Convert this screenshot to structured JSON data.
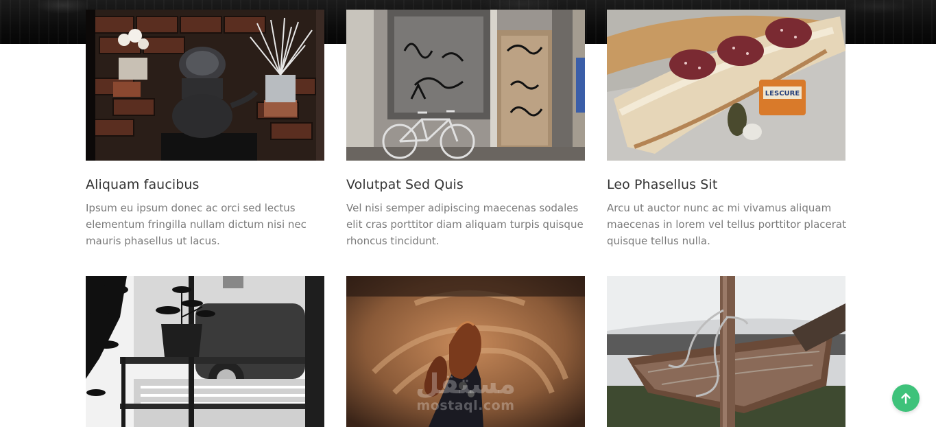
{
  "cards": [
    {
      "title": "Aliquam faucibus",
      "text": "Ipsum eu ipsum donec ac orci sed lectus elementum fringilla nullam dictum nisi nec mauris phasellus ut lacus.",
      "image_icon": "kettle-shelf-photo"
    },
    {
      "title": "Volutpat Sed Quis",
      "text": "Vel nisi semper adipiscing maecenas sodales elit cras porttitor diam aliquam turpis quisque rhoncus tincidunt.",
      "image_icon": "graffiti-door-bicycle-photo"
    },
    {
      "title": "Leo Phasellus Sit",
      "text": "Arcu ut auctor nunc ac mi vivamus aliquam maecenas in lorem vel tellus porttitor placerat quisque tellus nulla.",
      "image_icon": "bread-salami-photo"
    },
    {
      "image_icon": "plant-window-photo"
    },
    {
      "image_icon": "leather-shoe-photo"
    },
    {
      "image_icon": "wrecked-boat-photo"
    }
  ],
  "watermark": {
    "arabic": "مستقل",
    "latin": "mostaql.com"
  },
  "back_to_top": {
    "icon": "arrow-up-icon",
    "color": "#3ec27a"
  }
}
